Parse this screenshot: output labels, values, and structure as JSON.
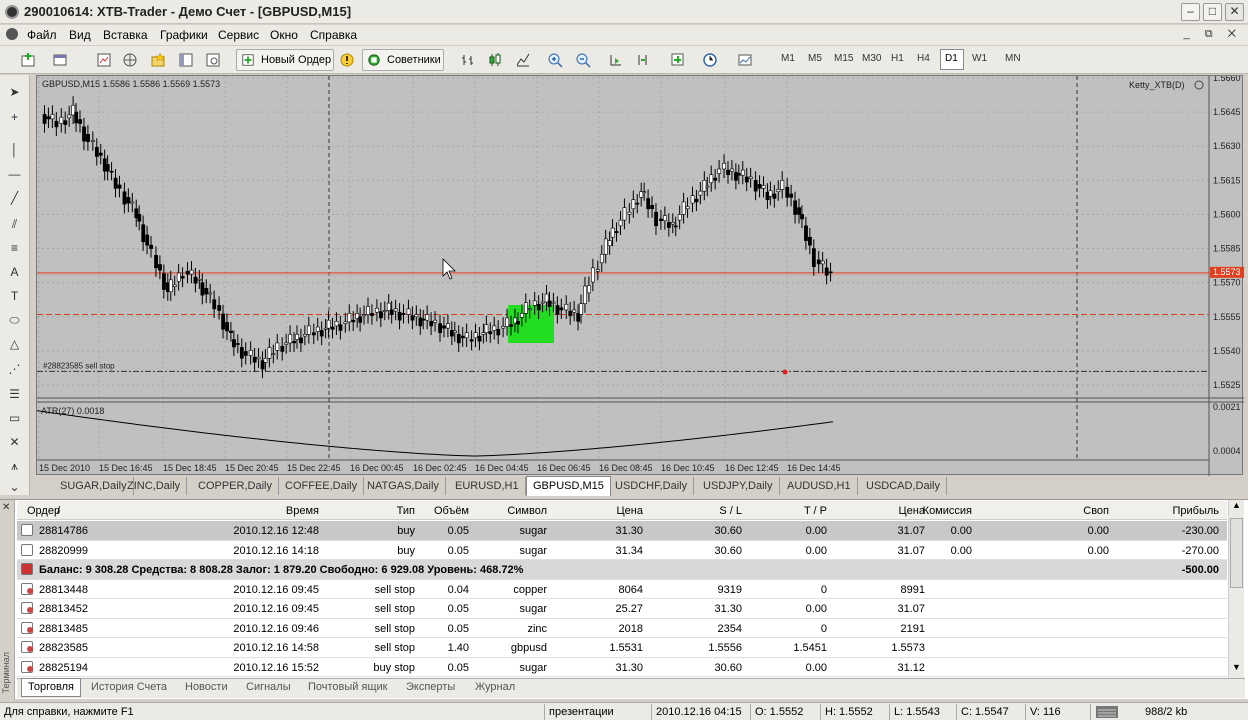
{
  "window": {
    "title": "290010614: XTB-Trader - Демо Счет - [GBPUSD,M15]"
  },
  "menu": [
    "Файл",
    "Вид",
    "Вставка",
    "Графики",
    "Сервис",
    "Окно",
    "Справка"
  ],
  "toolbar": {
    "new_order": "Новый Ордер",
    "experts": "Советники",
    "timeframes": [
      "M1",
      "M5",
      "M15",
      "M30",
      "H1",
      "H4",
      "D1",
      "W1",
      "MN"
    ],
    "active_timeframe": "D1"
  },
  "chart": {
    "header": "GBPUSD,M15  1.5586 1.5586 1.5569 1.5573",
    "expert_label": "Ketty_XTB(D)",
    "current_price": "1.5573",
    "order_label": "#28823585 sell stop",
    "indicator_label": "ATR(27) 0.0018",
    "indicator_ticks": [
      "0.0021",
      "0.0004"
    ],
    "price_ticks": [
      "1.5660",
      "1.5645",
      "1.5630",
      "1.5615",
      "1.5600",
      "1.5585",
      "1.5570",
      "1.5555",
      "1.5540",
      "1.5525"
    ],
    "time_labels": [
      "15 Dec 2010",
      "15 Dec 16:45",
      "15 Dec 18:45",
      "15 Dec 20:45",
      "15 Dec 22:45",
      "16 Dec 00:45",
      "16 Dec 02:45",
      "16 Dec 04:45",
      "16 Dec 06:45",
      "16 Dec 08:45",
      "16 Dec 10:45",
      "16 Dec 12:45",
      "16 Dec 14:45"
    ],
    "colors": {
      "background": "#c0c0c0",
      "bull": "#ffffff",
      "bear": "#000000",
      "highlight": "#22dd22",
      "bid_line": "#e04020"
    }
  },
  "chart_tabs": [
    "SUGAR,Daily",
    "ZINC,Daily",
    "COPPER,Daily",
    "COFFEE,Daily",
    "NATGAS,Daily",
    "EURUSD,H1",
    "GBPUSD,M15",
    "USDCHF,Daily",
    "USDJPY,Daily",
    "AUDUSD,H1",
    "USDCAD,Daily"
  ],
  "active_chart_tab": "GBPUSD,M15",
  "terminal": {
    "side_label": "Терминал",
    "columns": [
      "Ордер",
      "/",
      "Время",
      "Тип",
      "Объём",
      "Символ",
      "Цена",
      "S / L",
      "T / P",
      "Цена",
      "Комиссия",
      "Своп",
      "Прибыль"
    ],
    "rows": [
      {
        "order": "28814786",
        "time": "2010.12.16 12:48",
        "type": "buy",
        "volume": "0.05",
        "symbol": "sugar",
        "price": "31.30",
        "sl": "30.60",
        "tp": "0.00",
        "cur": "31.07",
        "commission": "0.00",
        "swap": "0.00",
        "profit": "-230.00"
      },
      {
        "order": "28820999",
        "time": "2010.12.16 14:18",
        "type": "buy",
        "volume": "0.05",
        "symbol": "sugar",
        "price": "31.34",
        "sl": "30.60",
        "tp": "0.00",
        "cur": "31.07",
        "commission": "0.00",
        "swap": "0.00",
        "profit": "-270.00"
      }
    ],
    "balance_line": "Баланс: 9 308.28  Средства: 8 808.28  Залог: 1 879.20  Свободно: 6 929.08  Уровень: 468.72%",
    "balance_profit": "-500.00",
    "pending": [
      {
        "order": "28813448",
        "time": "2010.12.16 09:45",
        "type": "sell stop",
        "volume": "0.04",
        "symbol": "copper",
        "price": "8064",
        "sl": "9319",
        "tp": "0",
        "cur": "8991"
      },
      {
        "order": "28813452",
        "time": "2010.12.16 09:45",
        "type": "sell stop",
        "volume": "0.05",
        "symbol": "sugar",
        "price": "25.27",
        "sl": "31.30",
        "tp": "0.00",
        "cur": "31.07"
      },
      {
        "order": "28813485",
        "time": "2010.12.16 09:46",
        "type": "sell stop",
        "volume": "0.05",
        "symbol": "zinc",
        "price": "2018",
        "sl": "2354",
        "tp": "0",
        "cur": "2191"
      },
      {
        "order": "28823585",
        "time": "2010.12.16 14:58",
        "type": "sell stop",
        "volume": "1.40",
        "symbol": "gbpusd",
        "price": "1.5531",
        "sl": "1.5556",
        "tp": "1.5451",
        "cur": "1.5573"
      },
      {
        "order": "28825194",
        "time": "2010.12.16 15:52",
        "type": "buy stop",
        "volume": "0.05",
        "symbol": "sugar",
        "price": "31.30",
        "sl": "30.60",
        "tp": "0.00",
        "cur": "31.12"
      }
    ],
    "tabs": [
      "Торговля",
      "История Счета",
      "Новости",
      "Сигналы",
      "Почтовый ящик",
      "Эксперты",
      "Журнал"
    ]
  },
  "status": {
    "help": "Для справки, нажмите F1",
    "profile": "презентации",
    "time": "2010.12.16 04:15",
    "open": "O: 1.5552",
    "high": "H: 1.5552",
    "low": "L: 1.5543",
    "close": "C: 1.5547",
    "volume": "V: 116",
    "traffic": "988/2 kb"
  }
}
